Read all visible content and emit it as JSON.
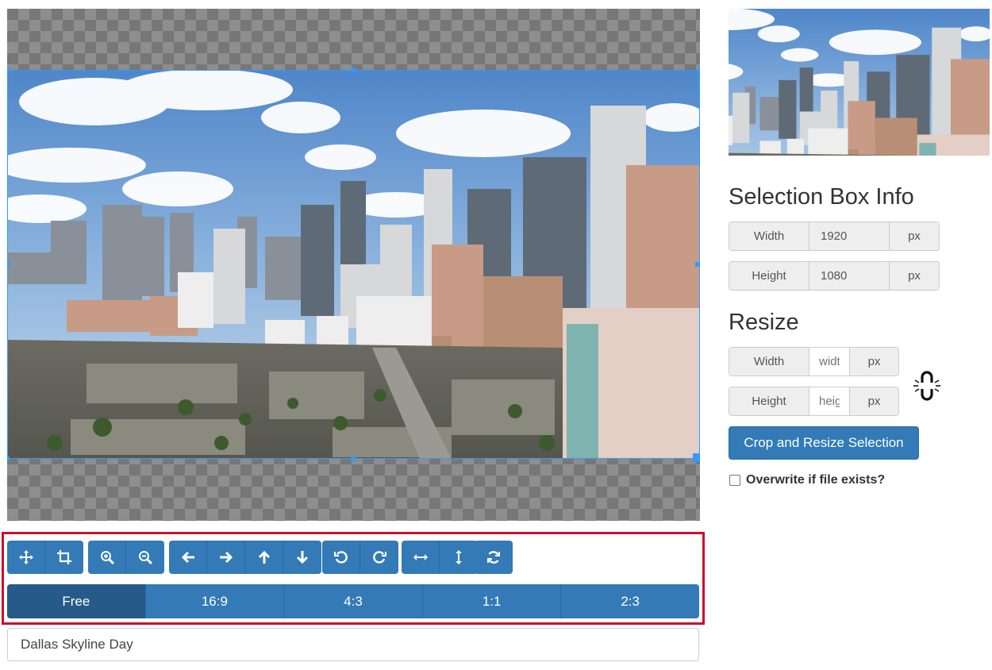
{
  "image_name": "Dallas Skyline Day",
  "selection_info": {
    "title": "Selection Box Info",
    "width_label": "Width",
    "width_value": "1920",
    "height_label": "Height",
    "height_value": "1080",
    "unit": "px"
  },
  "resize": {
    "title": "Resize",
    "width_label": "Width",
    "width_placeholder": "width",
    "height_label": "Height",
    "height_placeholder": "height",
    "unit": "px"
  },
  "crop_button_label": "Crop and Resize Selection",
  "overwrite_label": "Overwrite if file exists?",
  "aspect_ratios": [
    "Free",
    "16:9",
    "4:3",
    "1:1",
    "2:3"
  ],
  "active_ratio": "Free",
  "toolbar_icons": [
    [
      "move-icon",
      "crop-icon"
    ],
    [
      "zoom-in-icon",
      "zoom-out-icon"
    ],
    [
      "arrow-left-icon",
      "arrow-right-icon",
      "arrow-up-icon",
      "arrow-down-icon"
    ],
    [
      "rotate-left-icon",
      "rotate-right-icon"
    ],
    [
      "flip-horizontal-icon",
      "flip-vertical-icon"
    ],
    [
      "reset-icon"
    ]
  ],
  "colors": {
    "primary": "#337ab7",
    "primary_active": "#265a88",
    "highlight_frame": "#c8102e",
    "crop_border": "#3399ff"
  }
}
